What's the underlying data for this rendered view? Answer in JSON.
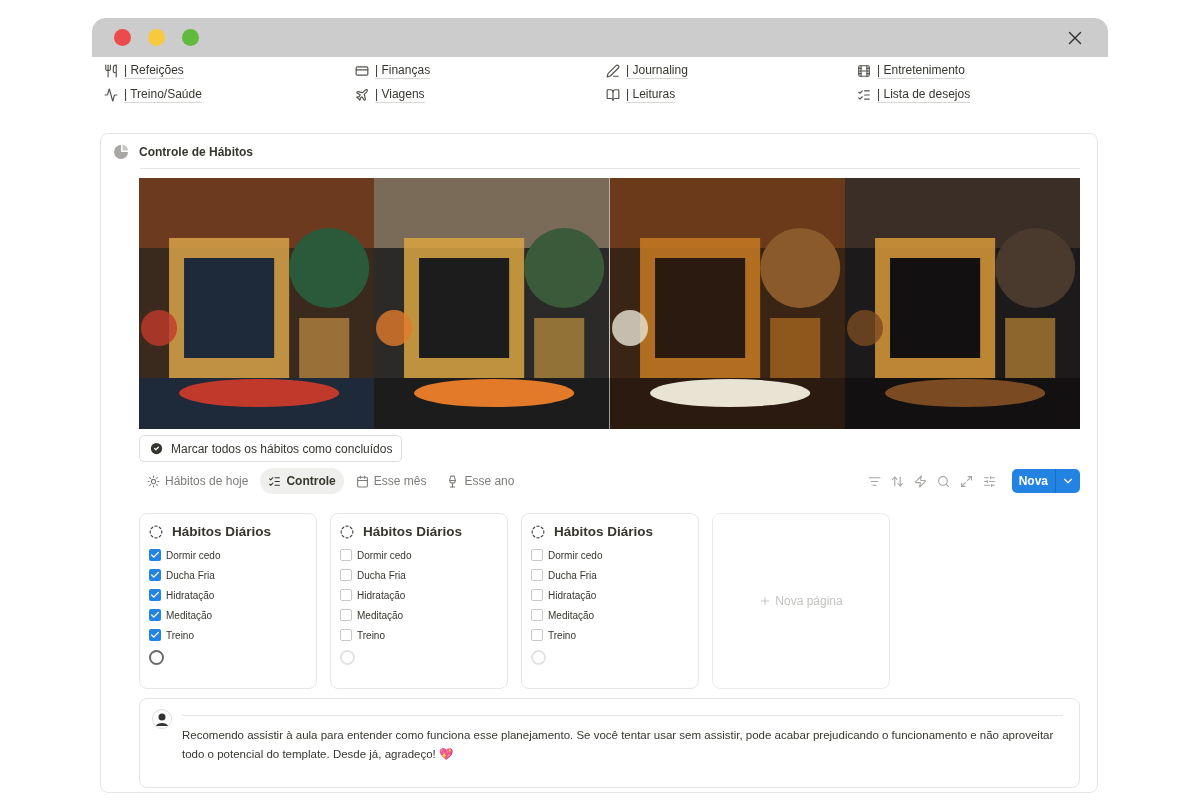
{
  "links": [
    {
      "label": "| Refeições"
    },
    {
      "label": "| Finanças"
    },
    {
      "label": "| Journaling"
    },
    {
      "label": "| Entretenimento"
    },
    {
      "label": "| Treino/Saúde"
    },
    {
      "label": "| Viagens"
    },
    {
      "label": "| Leituras"
    },
    {
      "label": "| Lista de desejos"
    }
  ],
  "section": {
    "title": "Controle de Hábitos",
    "action_button": "Marcar todos os hábitos como concluídos",
    "tabs": [
      {
        "label": "Hábitos de hoje",
        "selected": false
      },
      {
        "label": "Controle",
        "selected": true
      },
      {
        "label": "Esse mês",
        "selected": false
      },
      {
        "label": "Esse ano",
        "selected": false
      }
    ],
    "new_button": "Nova",
    "cards": [
      {
        "title": "Hábitos Diários",
        "complete": true,
        "items": [
          {
            "label": "Dormir cedo",
            "checked": true
          },
          {
            "label": "Ducha Fria",
            "checked": true
          },
          {
            "label": "Hidratação",
            "checked": true
          },
          {
            "label": "Meditação",
            "checked": true
          },
          {
            "label": "Treino",
            "checked": true
          }
        ]
      },
      {
        "title": "Hábitos Diários",
        "complete": false,
        "items": [
          {
            "label": "Dormir cedo",
            "checked": false
          },
          {
            "label": "Ducha Fria",
            "checked": false
          },
          {
            "label": "Hidratação",
            "checked": false
          },
          {
            "label": "Meditação",
            "checked": false
          },
          {
            "label": "Treino",
            "checked": false
          }
        ]
      },
      {
        "title": "Hábitos Diários",
        "complete": false,
        "items": [
          {
            "label": "Dormir cedo",
            "checked": false
          },
          {
            "label": "Ducha Fria",
            "checked": false
          },
          {
            "label": "Hidratação",
            "checked": false
          },
          {
            "label": "Meditação",
            "checked": false
          },
          {
            "label": "Treino",
            "checked": false
          }
        ]
      }
    ],
    "new_page": "Nova página",
    "comment": "Recomendo assistir à aula para entender como funciona esse planejamento. Se você tentar usar sem assistir, pode acabar prejudicando o funcionamento e não aproveitar todo o potencial do template. Desde já, agradeço! 💖"
  }
}
